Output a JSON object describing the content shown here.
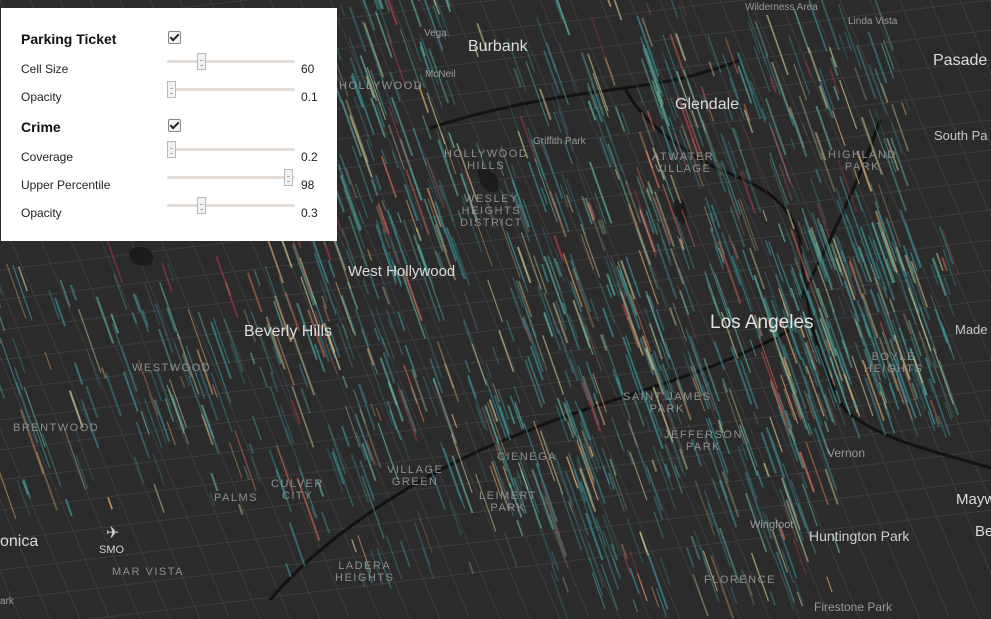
{
  "controls": {
    "parking": {
      "title": "Parking Ticket",
      "enabled": true,
      "cell_size": {
        "label": "Cell Size",
        "value": "60",
        "fraction": 0.25
      },
      "opacity": {
        "label": "Opacity",
        "value": "0.1",
        "fraction": 0.0
      }
    },
    "crime": {
      "title": "Crime",
      "enabled": true,
      "coverage": {
        "label": "Coverage",
        "value": "0.2",
        "fraction": 0.0
      },
      "upper_percentile": {
        "label": "Upper Percentile",
        "value": "98",
        "fraction": 0.98
      },
      "opacity": {
        "label": "Opacity",
        "value": "0.3",
        "fraction": 0.25
      }
    }
  },
  "map_labels": {
    "wilderness_area": "Wilderness Area",
    "linda_vista": "Linda Vista",
    "vega": "Vega",
    "burbank": "Burbank",
    "pasadena": "Pasade",
    "mcneil": "McNeil",
    "glendale": "Glendale",
    "hollywood": "HOLLYWOOD",
    "south_pas": "South Pa",
    "griffith_park": "Griffith Park",
    "hollywood_hills": "HOLLYWOOD\nHILLS",
    "atwater_village": "ATWATER\nVILLAGE",
    "highland_park": "HIGHLAND\nPARK",
    "wilshire_heights": "WESLEY\nHEIGHTS\nDISTRICT",
    "west_hollywood": "West Hollywood",
    "beverly_hills": "Beverly Hills",
    "los_angeles": "Los Angeles",
    "madera": "Made",
    "westwood": "WESTWOOD",
    "boyle_heights": "BOYLE\nHEIGHTS",
    "saint_james_park": "SAINT JAMES\nPARK",
    "jefferson_park": "JEFFERSON\nPARK",
    "brentwood": "BRENTWOOD",
    "cienega": "CIENEGA",
    "vernon": "Vernon",
    "village_green": "VILLAGE\nGREEN",
    "culver_city": "CULVER\nCITY",
    "palms": "PALMS",
    "leimert_park": "LEIMERT\nPARK",
    "maywood": "Mayw",
    "bell": "Be",
    "santa_monica": "onica",
    "smo": "SMO",
    "wingfoot": "Wingfoot",
    "huntington_park": "Huntington Park",
    "mar_vista": "MAR VISTA",
    "ladera_heights": "LADERA\nHEIGHTS",
    "florence": "FLORENCE",
    "firestone_park": "Firestone Park",
    "park_edge": "ark"
  },
  "colors": {
    "map_bg": "#2b2b2c",
    "road": "#3d3d3e",
    "highway": "#141414",
    "water": "#1e1f20",
    "cell_palette": [
      "#3a8f96",
      "#5fb5a3",
      "#c7c88f",
      "#e8b070",
      "#d66b55",
      "#b23b48"
    ]
  }
}
